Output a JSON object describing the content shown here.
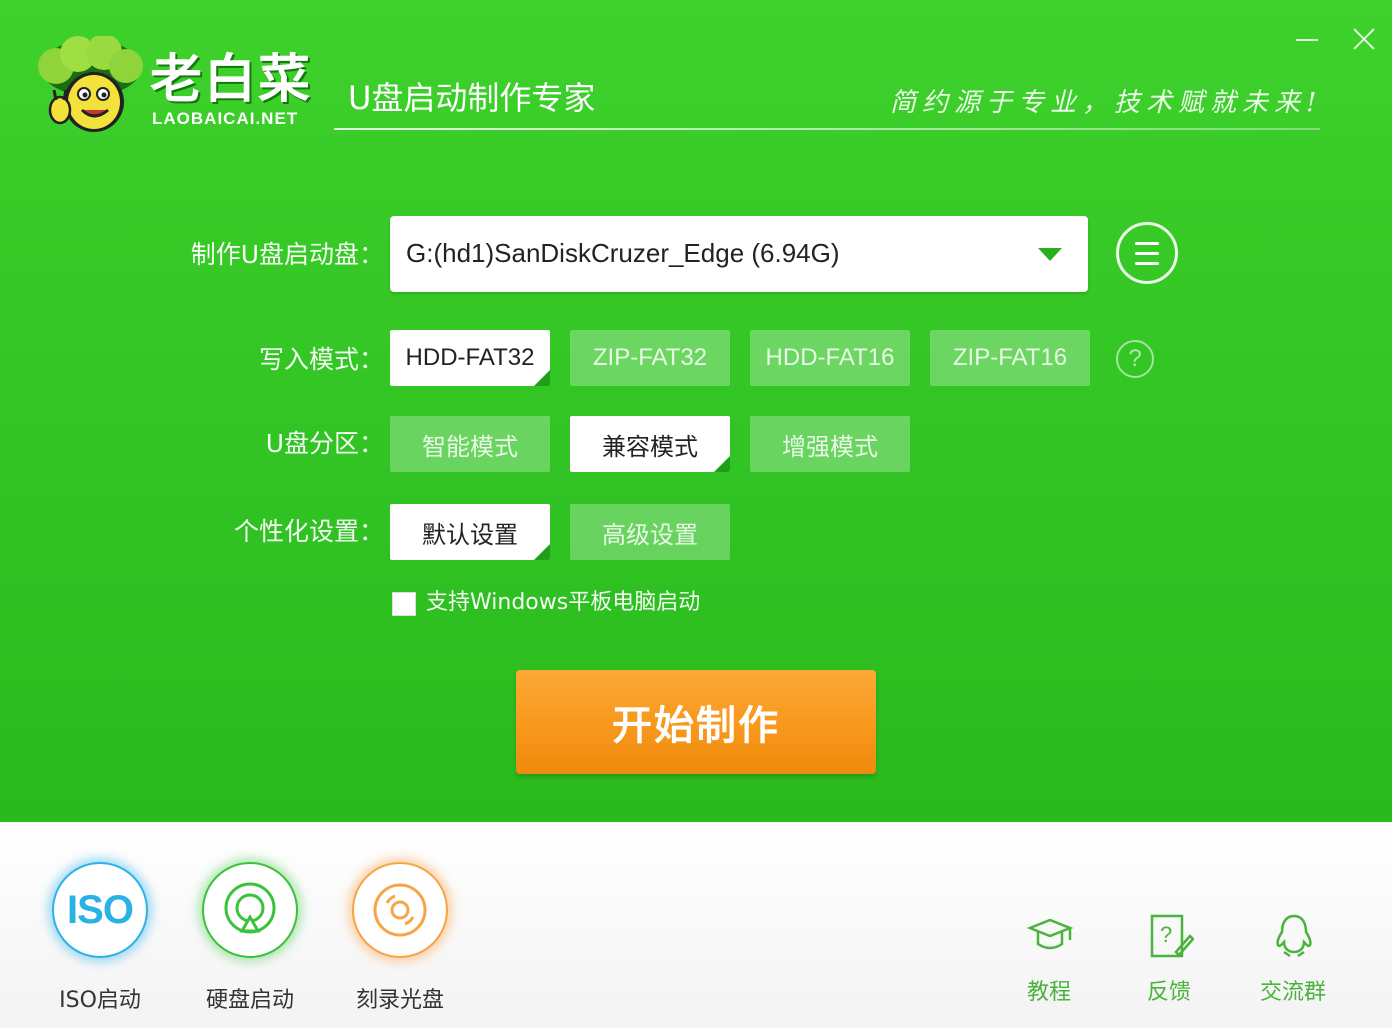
{
  "window": {
    "minimize_icon": "minimize-icon",
    "close_icon": "close-icon"
  },
  "header": {
    "brand_name": "老白菜",
    "brand_domain": "LAOBAICAI.NET",
    "subtitle": "U盘启动制作专家",
    "slogan": "简约源于专业，技术赋就未来!"
  },
  "form": {
    "drive_label": "制作U盘启动盘：",
    "drive_value": "G:(hd1)SanDiskCruzer_Edge (6.94G)",
    "write_mode_label": "写入模式：",
    "write_modes": [
      "HDD-FAT32",
      "ZIP-FAT32",
      "HDD-FAT16",
      "ZIP-FAT16"
    ],
    "write_mode_selected": "HDD-FAT32",
    "partition_label": "U盘分区：",
    "partition_modes": [
      "智能模式",
      "兼容模式",
      "增强模式"
    ],
    "partition_selected": "兼容模式",
    "personalize_label": "个性化设置：",
    "personalize_modes": [
      "默认设置",
      "高级设置"
    ],
    "personalize_selected": "默认设置",
    "help_glyph": "?",
    "tablet_checkbox_label": "支持Windows平板电脑启动",
    "tablet_checked": false,
    "start_button": "开始制作"
  },
  "tools": [
    {
      "label": "ISO启动",
      "icon": "iso-icon",
      "icon_text": "ISO",
      "color": "#2cb2e8"
    },
    {
      "label": "硬盘启动",
      "icon": "hard-disk-icon",
      "color": "#3bc23c"
    },
    {
      "label": "刻录光盘",
      "icon": "disc-icon",
      "color": "#f7a449"
    }
  ],
  "links": [
    {
      "label": "教程",
      "icon": "graduation-cap-icon"
    },
    {
      "label": "反馈",
      "icon": "feedback-icon"
    },
    {
      "label": "交流群",
      "icon": "qq-penguin-icon"
    }
  ],
  "colors": {
    "main_green": "#33c625",
    "accent_orange": "#f7961a",
    "link_green": "#49b33b"
  }
}
